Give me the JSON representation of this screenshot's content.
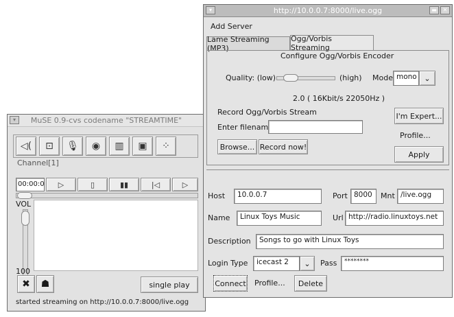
{
  "muse": {
    "title": "MuSE 0.9-cvs codename \"STREAMTIME\"",
    "toolbar_icons": [
      "speaker-icon",
      "window-icon",
      "microphone-icon",
      "disc-icon",
      "equalizer-icon",
      "document-icon",
      "grid-icon"
    ],
    "channel_label": "Channel[1]",
    "time": "00:00:00",
    "vol_label": "VOL",
    "vol_value": "100",
    "play_mode": "single play",
    "status": "started streaming on http://10.0.0.7:8000/live.ogg"
  },
  "stream": {
    "title": "http://10.0.0.7:8000/live.ogg",
    "menu_add_server": "Add Server",
    "tabs": [
      "Lame Streaming (MP3)",
      "Ogg/Vorbis Streaming"
    ],
    "configure_title": "Configure Ogg/Vorbis Encoder",
    "quality_label": "Quality: (low)",
    "quality_high": "(high)",
    "mode_label": "Mode",
    "mode_value": "mono",
    "quality_info": "2.0 ( 16Kbit/s 22050Hz )",
    "record_label": "Record Ogg/Vorbis Stream",
    "enter_filename": "Enter filename",
    "filename_value": "",
    "browse_btn": "Browse...",
    "record_btn": "Record now!",
    "expert_btn": "I'm Expert...",
    "profile_label": "Profile...",
    "apply_btn": "Apply",
    "host_label": "Host",
    "host_value": "10.0.0.7",
    "port_label": "Port",
    "port_value": "8000",
    "mnt_label": "Mnt",
    "mnt_value": "/live.ogg",
    "name_label": "Name",
    "name_value": "Linux Toys Music",
    "url_label": "Url",
    "url_value": "http://radio.linuxtoys.net",
    "desc_label": "Description",
    "desc_value": "Songs to go with Linux Toys",
    "login_label": "Login Type",
    "login_value": "icecast 2",
    "pass_label": "Pass",
    "pass_value": "********",
    "connect_btn": "Connect",
    "profile_btn": "Profile...",
    "delete_btn": "Delete"
  },
  "colors": {
    "window_bg": "#e4e4e4",
    "titlebar": "#bcbcbc",
    "border": "#8a8a8a"
  }
}
